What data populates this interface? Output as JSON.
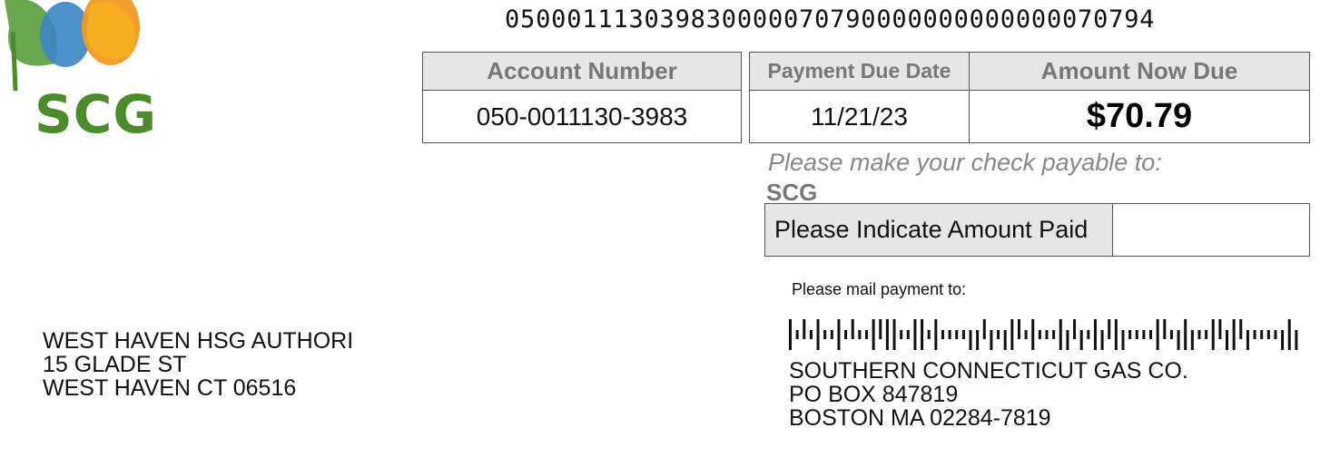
{
  "logo": {
    "text": "SCG"
  },
  "scan_line": "050001113039830000070790000000000000070794",
  "account": {
    "header": "Account Number",
    "value": "050-0011130-3983"
  },
  "due": {
    "date_header": "Payment Due Date",
    "date_value": "11/21/23",
    "amount_header": "Amount Now Due",
    "amount_value": "$70.79"
  },
  "payable": {
    "label": "Please make your check payable to:",
    "name": "SCG"
  },
  "amount_paid": {
    "label": "Please Indicate Amount Paid",
    "value": ""
  },
  "mail": {
    "label": "Please mail payment to:"
  },
  "remit_address": [
    "SOUTHERN CONNECTICUT GAS CO.",
    "PO BOX 847819",
    "BOSTON MA 02284-7819"
  ],
  "customer_address": [
    "WEST HAVEN HSG AUTHORI",
    "15 GLADE ST",
    "WEST HAVEN CT 06516"
  ],
  "barcode": {
    "pattern": "FTATFTTFTATTFAFFTTFFTFTTTTDDADTDFATFTTTFDADTFDAFDTTTTFATDFDTTFADFADTTTTDFD"
  },
  "colors": {
    "brand_green": "#4a8c2a",
    "header_gray": "#e6e6e6"
  }
}
